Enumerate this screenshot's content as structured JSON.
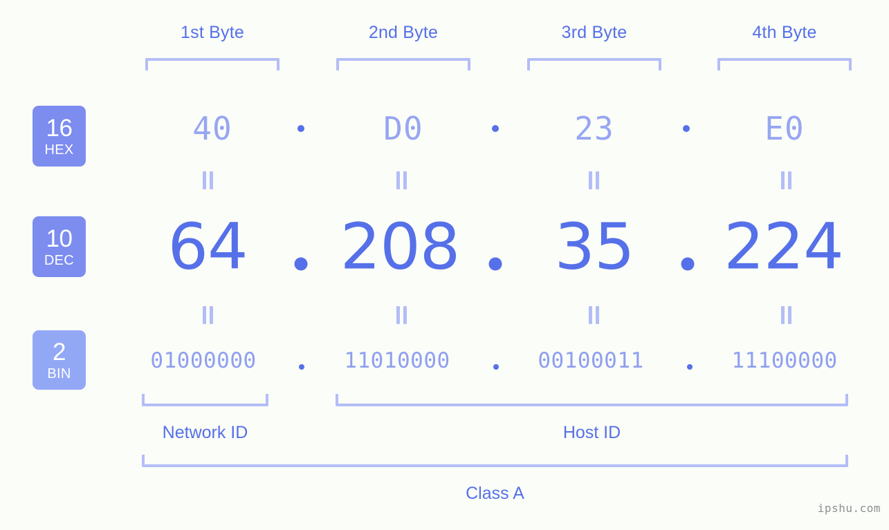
{
  "background_color": "#fbfdf8",
  "accent_color": "#5570e8",
  "accent_light_color": "#97a6f2",
  "bracket_color": "#b3bdf7",
  "byte_headers": [
    {
      "label": "1st Byte"
    },
    {
      "label": "2nd Byte"
    },
    {
      "label": "3rd Byte"
    },
    {
      "label": "4th Byte"
    }
  ],
  "bases": {
    "hex": {
      "number": "16",
      "name": "HEX",
      "badge_color": "#7c8cef"
    },
    "dec": {
      "number": "10",
      "name": "DEC",
      "badge_color": "#7c8cef"
    },
    "bin": {
      "number": "2",
      "name": "BIN",
      "badge_color": "#93a8f5"
    }
  },
  "rows": {
    "hex": {
      "values": [
        "40",
        "D0",
        "23",
        "E0"
      ],
      "separator": "."
    },
    "dec": {
      "values": [
        "64",
        "208",
        "35",
        "224"
      ],
      "separator": "."
    },
    "bin": {
      "values": [
        "01000000",
        "11010000",
        "00100011",
        "11100000"
      ],
      "separator": "."
    }
  },
  "equality_marks": [
    "=",
    "=",
    "=",
    "=",
    "=",
    "=",
    "=",
    "="
  ],
  "sections": {
    "network_id": "Network ID",
    "host_id": "Host ID",
    "class": "Class A"
  },
  "watermark": "ipshu.com",
  "ip_address": {
    "hex": "40.D0.23.E0",
    "dec": "64.208.35.224",
    "bin": "01000000.11010000.00100011.11100000"
  }
}
